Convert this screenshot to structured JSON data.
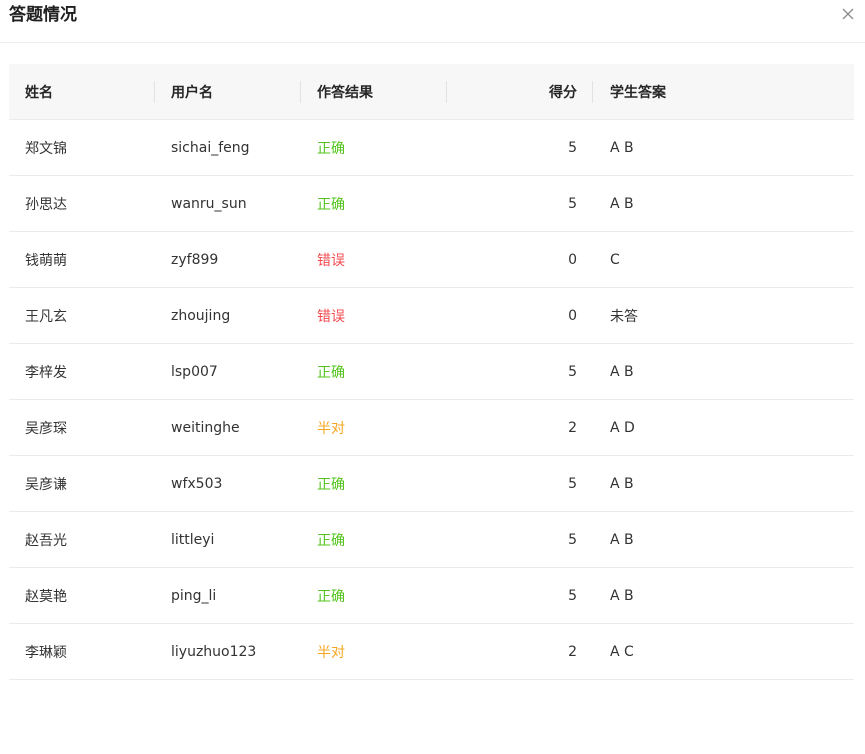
{
  "dialog": {
    "title": "答题情况",
    "close_icon": "close-icon"
  },
  "table": {
    "headers": {
      "name": "姓名",
      "username": "用户名",
      "result": "作答结果",
      "score": "得分",
      "answer": "学生答案"
    },
    "rows": [
      {
        "name": "郑文锦",
        "username": "sichai_feng",
        "result": "正确",
        "result_type": "correct",
        "score": "5",
        "answer": "A B"
      },
      {
        "name": "孙思达",
        "username": "wanru_sun",
        "result": "正确",
        "result_type": "correct",
        "score": "5",
        "answer": "A B"
      },
      {
        "name": "钱萌萌",
        "username": "zyf899",
        "result": "错误",
        "result_type": "wrong",
        "score": "0",
        "answer": "C"
      },
      {
        "name": "王凡玄",
        "username": "zhoujing",
        "result": "错误",
        "result_type": "wrong",
        "score": "0",
        "answer": "未答"
      },
      {
        "name": "李梓发",
        "username": "lsp007",
        "result": "正确",
        "result_type": "correct",
        "score": "5",
        "answer": "A B"
      },
      {
        "name": "吴彦琛",
        "username": "weitinghe",
        "result": "半对",
        "result_type": "partial",
        "score": "2",
        "answer": "A D"
      },
      {
        "name": "吴彦谦",
        "username": "wfx503",
        "result": "正确",
        "result_type": "correct",
        "score": "5",
        "answer": "A B"
      },
      {
        "name": "赵吾光",
        "username": "littleyi",
        "result": "正确",
        "result_type": "correct",
        "score": "5",
        "answer": "A B"
      },
      {
        "name": "赵莫艳",
        "username": "ping_li",
        "result": "正确",
        "result_type": "correct",
        "score": "5",
        "answer": "A B"
      },
      {
        "name": "李琳颖",
        "username": "liyuzhuo123",
        "result": "半对",
        "result_type": "partial",
        "score": "2",
        "answer": "A C"
      }
    ]
  },
  "colors": {
    "correct": "#52c41a",
    "wrong": "#f5474e",
    "partial": "#f5a623"
  }
}
